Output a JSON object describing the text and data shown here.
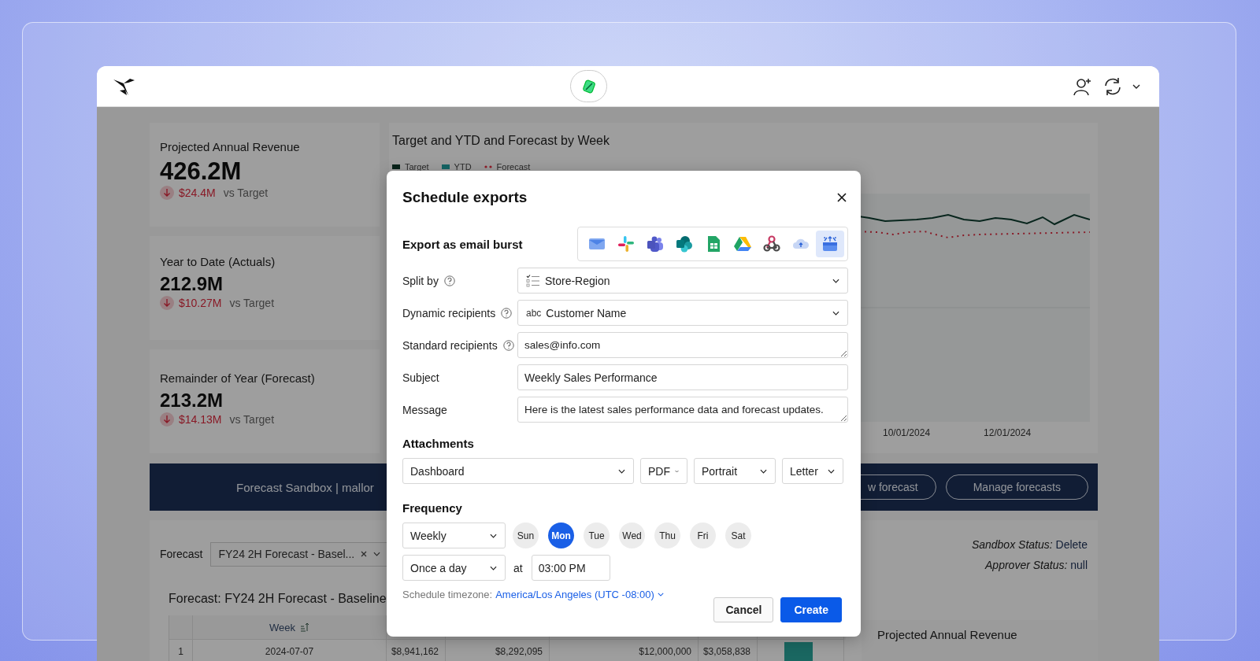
{
  "kpis": [
    {
      "title": "Projected Annual Revenue",
      "value": "426.2M",
      "delta": "$24.4M",
      "comparison": "vs Target"
    },
    {
      "title": "Year to Date (Actuals)",
      "value": "212.9M",
      "delta": "$10.27M",
      "comparison": "vs Target"
    },
    {
      "title": "Remainder of Year (Forecast)",
      "value": "213.2M",
      "delta": "$14.13M",
      "comparison": "vs Target"
    }
  ],
  "chart": {
    "title": "Target and YTD and Forecast by Week",
    "legend": [
      {
        "label": "Target",
        "color": "#082219"
      },
      {
        "label": "YTD",
        "color": "#136060"
      },
      {
        "label": "Forecast",
        "color": "#8a1a26"
      }
    ],
    "x_labels": [
      "10/01/2024",
      "12/01/2024"
    ]
  },
  "banner": {
    "title": "Forecast Sandbox | mallor",
    "buttons": [
      "w forecast",
      "Manage forecasts"
    ]
  },
  "forecast_filter": {
    "label": "Forecast",
    "value": "FY24 2H Forecast - Basel..."
  },
  "statuses": [
    {
      "label": "Sandbox Status:",
      "value": "Delete"
    },
    {
      "label": "Approver Status:",
      "value": "null"
    }
  ],
  "table": {
    "title": "Forecast: FY24 2H Forecast - Baseline",
    "columns": [
      "Week"
    ],
    "rows": [
      {
        "index": "1",
        "cells": [
          "2024-07-07",
          "$8,941,162",
          "$8,292,095",
          "$12,000,000",
          "$3,058,838"
        ],
        "level": 0.5
      }
    ]
  },
  "side_card": {
    "title": "Projected Annual Revenue"
  },
  "dialog": {
    "title": "Schedule exports",
    "export_label": "Export as email burst",
    "destinations": [
      {
        "kind": "envelope",
        "selected": false
      },
      {
        "kind": "pinwheel",
        "selected": false
      },
      {
        "kind": "people",
        "selected": false
      },
      {
        "kind": "circles",
        "selected": false
      },
      {
        "kind": "sheet",
        "selected": false
      },
      {
        "kind": "triangle",
        "selected": false
      },
      {
        "kind": "webhook",
        "selected": false
      },
      {
        "kind": "cloud",
        "selected": false
      },
      {
        "kind": "tray",
        "selected": true
      }
    ],
    "fields": [
      {
        "kind": "select",
        "label": "Split by",
        "help": true,
        "value": "Store-Region"
      },
      {
        "kind": "select",
        "label": "Dynamic recipients",
        "help": true,
        "prefix": "abc",
        "value": "Customer Name"
      },
      {
        "kind": "textarea",
        "label": "Standard recipients",
        "help": true,
        "value": "sales@info.com"
      },
      {
        "kind": "input",
        "label": "Subject",
        "help": false,
        "value": "Weekly Sales Performance"
      },
      {
        "kind": "textarea",
        "label": "Message",
        "help": false,
        "value": "Here is the latest sales performance data and forecast updates."
      }
    ],
    "attachments": {
      "label": "Attachments",
      "selects": [
        "Dashboard",
        "PDF",
        "Portrait",
        "Letter"
      ]
    },
    "frequency": {
      "label": "Frequency",
      "repeat": "Weekly",
      "days": [
        {
          "label": "Sun",
          "selected": false
        },
        {
          "label": "Mon",
          "selected": true
        },
        {
          "label": "Tue",
          "selected": false
        },
        {
          "label": "Wed",
          "selected": false
        },
        {
          "label": "Thu",
          "selected": false
        },
        {
          "label": "Fri",
          "selected": false
        },
        {
          "label": "Sat",
          "selected": false
        }
      ],
      "times": "Once a day",
      "at": "at",
      "time": "03:00 PM"
    },
    "timezone": {
      "label": "Schedule timezone:",
      "value": "America/Los Angeles (UTC -08:00)"
    },
    "buttons": [
      {
        "label": "Cancel",
        "kind": "secondary"
      },
      {
        "label": "Create",
        "kind": "primary"
      }
    ]
  }
}
